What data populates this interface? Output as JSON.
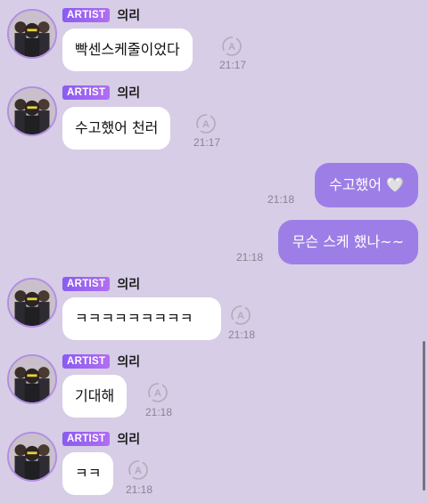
{
  "artist_badge": "ARTIST",
  "artist_name": "의리",
  "icons": {
    "avatar": "group-photo-avatar",
    "translate": "translate-icon",
    "heart": "white-heart-emoji"
  },
  "colors": {
    "background": "#d7cde6",
    "incoming_bubble": "#ffffff",
    "outgoing_bubble": "#9d7ee6",
    "badge": "#8a5cf0"
  },
  "messages": [
    {
      "direction": "in",
      "text": "빡센스케줄이었다",
      "time": "21:17"
    },
    {
      "direction": "in",
      "text": "수고했어 천러",
      "time": "21:17"
    },
    {
      "direction": "out",
      "text": "수고했어 🤍",
      "time": "21:18"
    },
    {
      "direction": "out",
      "text": "무슨 스케 했나~~",
      "time": "21:18"
    },
    {
      "direction": "in",
      "text": "ㅋㅋㅋㅋㅋㅋㅋㅋㅋ",
      "time": "21:18"
    },
    {
      "direction": "in",
      "text": "기대해",
      "time": "21:18"
    },
    {
      "direction": "in",
      "text": "ㅋㅋ",
      "time": "21:18"
    }
  ]
}
